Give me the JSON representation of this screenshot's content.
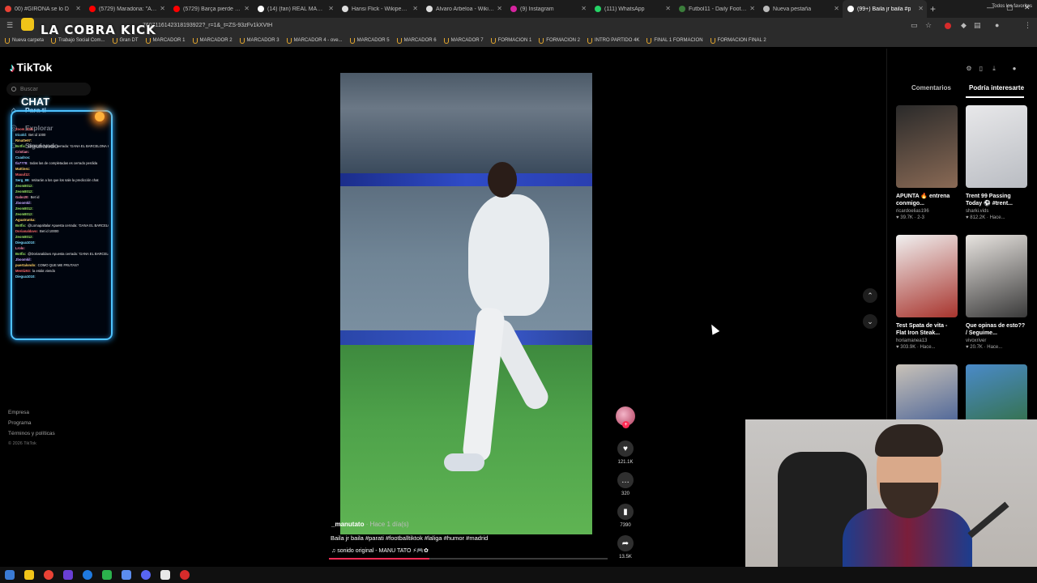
{
  "browser": {
    "tabs": [
      {
        "label": "00) #GIRONA se lo D",
        "icon_color": "#e94235"
      },
      {
        "label": "(5729) Maradona: \"A jug",
        "icon_color": "#ff0000"
      },
      {
        "label": "(5729) Barça pierde el lid",
        "icon_color": "#ff0000"
      },
      {
        "label": "(14) (fan) REAL MADRID",
        "icon_color": "#ffffff"
      },
      {
        "label": "Hansi Flick - Wikipedia, la",
        "icon_color": "#dddddd"
      },
      {
        "label": "Álvaro Arbeloa - Wikiped",
        "icon_color": "#dddddd"
      },
      {
        "label": "(9) Instagram",
        "icon_color": "#d6249f"
      },
      {
        "label": "(111) WhatsApp",
        "icon_color": "#25d366"
      },
      {
        "label": "Futbol11 - Daily Football",
        "icon_color": "#3b7d3b"
      },
      {
        "label": "Nueva pestaña",
        "icon_color": "#bbbbbb"
      },
      {
        "label": "(99+) Baila jr baila #p",
        "icon_color": "#ffffff",
        "active": true
      }
    ],
    "url": "7607116142318193922?_r=1&_t=ZS-93zFv1kXVtH",
    "bookmarks": [
      "Nueva carpeta",
      "Trabajo Social Com...",
      "Gran DT",
      "MARCADOR 1",
      "MARCADOR 2",
      "MARCADOR 3",
      "MARCADOR 4 - ove...",
      "MARCADOR 5",
      "MARCADOR 6",
      "MARCADOR 7",
      "FORMACION 1",
      "FORMACION 2",
      "INTRO PARTIDO 4K",
      "FINAL 1 FORMACION",
      "FORMACION FINAL 2"
    ],
    "bookmarks_all": "Todos los favoritos"
  },
  "overlay": {
    "brand": "LA COBRA KICK",
    "chat_title": "CHAT",
    "chat_lines": [
      {
        "user": "Zoom_V22:",
        "msg": "",
        "color": "#ff6b6b"
      },
      {
        "user": "tricold:",
        "msg": "Bet id 1000",
        "color": "#7bdcff"
      },
      {
        "user": "Rmatte97:",
        "msg": "",
        "color": "#ffd166"
      },
      {
        "user": "Botfix:",
        "msg": "@lomotfh Apuesta cerrada: 'GANA EL BARCELONA HOY?'",
        "color": "#9be564"
      },
      {
        "user": "Cristian:",
        "msg": "",
        "color": "#ff8fab"
      },
      {
        "user": "Cuadros:",
        "msg": "",
        "color": "#7bdcff"
      },
      {
        "user": "tla7778:",
        "msg": "todas las de completadas es cerrado perdida",
        "color": "#c3a6ff"
      },
      {
        "user": "Mattinez:",
        "msg": "",
        "color": "#ffd166"
      },
      {
        "user": "Mauul12:",
        "msg": "",
        "color": "#ff6b6b"
      },
      {
        "user": "Serg_99:",
        "msg": "retirarán a los que los sale la predicción chat",
        "color": "#7bdcff"
      },
      {
        "user": "Zeom8012:",
        "msg": "",
        "color": "#9be564"
      },
      {
        "user": "Zeom8012:",
        "msg": "",
        "color": "#9be564"
      },
      {
        "user": "Gabo20:",
        "msg": "Bet id",
        "color": "#ff8fab"
      },
      {
        "user": "Jboomkil:",
        "msg": "",
        "color": "#c3a6ff"
      },
      {
        "user": "Zeom8012:",
        "msg": "",
        "color": "#9be564"
      },
      {
        "user": "Zeom8012:",
        "msg": "",
        "color": "#9be564"
      },
      {
        "user": "Aguatrunka:",
        "msg": "",
        "color": "#ffd166"
      },
      {
        "user": "Botfix:",
        "msg": "@Lomapaltalar Apuesta cerrada: 'GANA EL BARCELONA HOY?'",
        "color": "#9be564"
      },
      {
        "user": "Dorianaldavo:",
        "msg": "Bet id 10000",
        "color": "#ff6b6b"
      },
      {
        "user": "Zeom8012:",
        "msg": "",
        "color": "#9be564"
      },
      {
        "user": "Diegua1010:",
        "msg": "",
        "color": "#7bdcff"
      },
      {
        "user": "Lrolo:",
        "msg": "",
        "color": "#ff8fab"
      },
      {
        "user": "Botfix:",
        "msg": "@Dorianaldavo Apuesta cerrada: 'GANA EL BARCELONA HOY?'",
        "color": "#9be564"
      },
      {
        "user": "Jboomkil:",
        "msg": "",
        "color": "#c3a6ff"
      },
      {
        "user": "puertalondo:",
        "msg": "COMO QUE ME FRUTAS?",
        "color": "#ffd166"
      },
      {
        "user": "Mentiz93:",
        "msg": "la estás viendo",
        "color": "#ff6b6b"
      },
      {
        "user": "Diegua1010:",
        "msg": "",
        "color": "#7bdcff"
      }
    ]
  },
  "tiktok": {
    "logo": "TikTok",
    "search_placeholder": "Buscar",
    "nav": [
      {
        "label": "Para ti",
        "icon": "home-icon",
        "glyph": "⌂"
      },
      {
        "label": "Explorar",
        "icon": "compass-icon",
        "glyph": "◎"
      },
      {
        "label": "Siguiendo",
        "icon": "following-icon",
        "glyph": "☺"
      }
    ],
    "footer": [
      "Empresa",
      "Programa",
      "Términos y políticas"
    ],
    "copyright": "© 2026 TikTok",
    "video": {
      "author": "_manutato",
      "posted": "· Hace 1 día(s)",
      "caption": "Baila jr baila #parati #footballtiktok #laliga #humor #madrid",
      "sound": "♫  sonido original - MANU TATO ⚡🎮✿",
      "progress": 0.36,
      "likes": "121.1K",
      "comments": "320",
      "saves": "7390",
      "shares": "13.5K"
    },
    "panel": {
      "tab_comments": "Comentarios",
      "tab_recommended": "Podría interesarte",
      "cards": [
        {
          "title": "APUNTA 🔥 entrena conmigo...",
          "user": "ricardoelias196",
          "stats": "♥ 39.7K · 2-3",
          "thumb": [
            "#2a2a2a",
            "#8a6a55"
          ]
        },
        {
          "title": "Trent 99 Passing Today ⚽ #trent...",
          "user": "sharki.vids",
          "stats": "♥ 812.2K · Hace...",
          "thumb": [
            "#e8e8ea",
            "#b9bcc2"
          ]
        },
        {
          "title": "Test Spata de vita - Flat Iron Steak...",
          "user": "horiamanea13",
          "stats": "♥ 303.9K · Hace...",
          "thumb": [
            "#f0f0f0",
            "#a8342d"
          ]
        },
        {
          "title": "Que opinas de esto?? / Seguime...",
          "user": "vivoxriver",
          "stats": "♥ 20.7K · Hace...",
          "thumb": [
            "#e8e4e0",
            "#3a3a3a"
          ]
        },
        {
          "title": "",
          "user": "",
          "stats": "",
          "thumb": [
            "#c9c2b8",
            "#2a4b8f"
          ]
        },
        {
          "title": "",
          "user": "",
          "stats": "",
          "thumb": [
            "#4a8ac9",
            "#2f6b2a"
          ]
        }
      ]
    }
  }
}
